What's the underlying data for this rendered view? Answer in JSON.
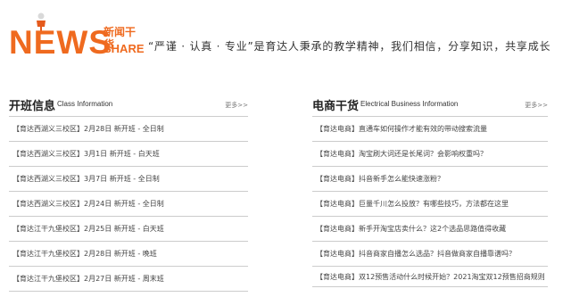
{
  "header": {
    "logo_main": "NEWS",
    "logo_cn": "新闻干货",
    "logo_en": "SHARE",
    "slogan": "“严谨 · 认真 · 专业”是育达人秉承的教学精神，我们相信，分享知识，共享成长"
  },
  "class_info": {
    "title": "开班信息",
    "subtitle": "Class Information",
    "more": "更多>>",
    "items": [
      "【育达西湖义三校区】2月28日 新开班 - 全日制",
      "【育达西湖义三校区】3月1日 新开班 - 白天班",
      "【育达西湖义三校区】3月7日 新开班 - 全日制",
      "【育达西湖义三校区】2月24日 新开班 - 全日制",
      "【育达江干九堡校区】2月25日 新开班 - 白天班",
      "【育达江干九堡校区】2月28日 新开班 - 晚班",
      "【育达江干九堡校区】2月27日 新开班 - 周末班"
    ]
  },
  "ecommerce": {
    "title": "电商干货",
    "subtitle": "Electrical Business Information",
    "more": "更多>>",
    "items": [
      "【育达电商】直通车如何操作才能有效的带动搜索流量",
      "【育达电商】淘宝刷大词还是长尾词？会影响权重吗？",
      "【育达电商】抖音新手怎么能快速涨粉？",
      "【育达电商】巨量千川怎么投放？有哪些技巧，方法都在这里",
      "【育达电商】新手开淘宝店卖什么？这2个选品思路值得收藏",
      "【育达电商】抖音商家自播怎么选品？抖音做商家自播靠谱吗？",
      "【育达电商】双12预售活动什么时候开始？2021淘宝双12预售招商规则"
    ]
  },
  "colors": {
    "brand_orange": "#ef6a1f"
  }
}
